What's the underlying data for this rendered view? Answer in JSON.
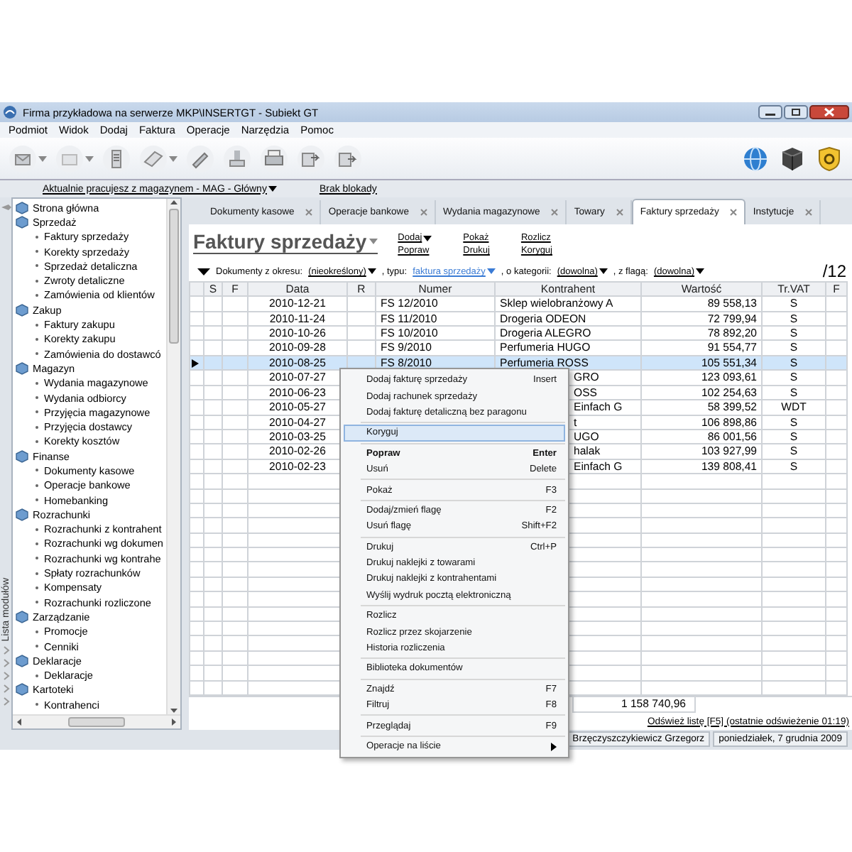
{
  "window": {
    "title": "Firma przykładowa na serwerze MKP\\INSERTGT - Subiekt GT"
  },
  "menu_bar": [
    "Podmiot",
    "Widok",
    "Dodaj",
    "Faktura",
    "Operacje",
    "Narzędzia",
    "Pomoc"
  ],
  "info_bar": {
    "warehouse": "Aktualnie pracujesz z magazynem - MAG - Główny",
    "lock": "Brak blokady"
  },
  "sidebar": {
    "label": "Lista modułów",
    "groups": [
      {
        "label": "Strona główna"
      },
      {
        "label": "Sprzedaż",
        "children": [
          "Faktury sprzedaży",
          "Korekty sprzedaży",
          "Sprzedaż detaliczna",
          "Zwroty detaliczne",
          "Zamówienia od klientów"
        ]
      },
      {
        "label": "Zakup",
        "children": [
          "Faktury zakupu",
          "Korekty zakupu",
          "Zamówienia do dostawcó"
        ]
      },
      {
        "label": "Magazyn",
        "children": [
          "Wydania magazynowe",
          "Wydania odbiorcy",
          "Przyjęcia magazynowe",
          "Przyjęcia dostawcy",
          "Korekty kosztów"
        ]
      },
      {
        "label": "Finanse",
        "children": [
          "Dokumenty kasowe",
          "Operacje bankowe",
          "Homebanking"
        ]
      },
      {
        "label": "Rozrachunki",
        "children": [
          "Rozrachunki z kontrahent",
          "Rozrachunki wg dokumen",
          "Rozrachunki wg kontrahe",
          "Spłaty rozrachunków",
          "Kompensaty",
          "Rozrachunki rozliczone"
        ]
      },
      {
        "label": "Zarządzanie",
        "children": [
          "Promocje",
          "Cenniki"
        ]
      },
      {
        "label": "Deklaracje",
        "children": [
          "Deklaracje"
        ]
      },
      {
        "label": "Kartoteki",
        "children": [
          "Kontrahenci"
        ]
      }
    ]
  },
  "tabs": [
    {
      "label": "Dokumenty kasowe",
      "selected": false
    },
    {
      "label": "Operacje bankowe",
      "selected": false
    },
    {
      "label": "Wydania magazynowe",
      "selected": false
    },
    {
      "label": "Towary",
      "selected": false
    },
    {
      "label": "Faktury sprzedaży",
      "selected": true
    },
    {
      "label": "Instytucje",
      "selected": false
    }
  ],
  "view": {
    "title": "Faktury sprzedaży",
    "actions": [
      {
        "label": "Dodaj",
        "dropdown": true
      },
      {
        "label": "Popraw",
        "dropdown": false
      },
      {
        "label": "Pokaż",
        "dropdown": false
      },
      {
        "label": "Drukuj",
        "dropdown": false
      },
      {
        "label": "Rozlicz",
        "dropdown": false
      },
      {
        "label": "Koryguj",
        "dropdown": false
      }
    ]
  },
  "filter": {
    "parts": [
      {
        "kind": "text",
        "text": "Dokumenty z okresu:"
      },
      {
        "kind": "choice",
        "text": "(nieokreślony)"
      },
      {
        "kind": "text",
        "text": ", typu:"
      },
      {
        "kind": "type",
        "text": "faktura sprzedaży"
      },
      {
        "kind": "text",
        "text": ", o kategorii:"
      },
      {
        "kind": "choice",
        "text": "(dowolna)"
      },
      {
        "kind": "text",
        "text": ", z flagą:"
      },
      {
        "kind": "choice",
        "text": "(dowolna)"
      }
    ],
    "count": "/12"
  },
  "table": {
    "columns": [
      "S",
      "F",
      "Data",
      "R",
      "Numer",
      "Kontrahent",
      "Wartość",
      "Tr.VAT",
      "F"
    ],
    "rows": [
      {
        "date": "2010-12-21",
        "number": "FS 12/2010",
        "contractor": "Sklep wielobranżowy  A",
        "value": "89 558,13",
        "vat": "S",
        "selected": false,
        "partly_hidden": false
      },
      {
        "date": "2010-11-24",
        "number": "FS 11/2010",
        "contractor": "Drogeria ODEON",
        "value": "72 799,94",
        "vat": "S",
        "selected": false,
        "partly_hidden": false
      },
      {
        "date": "2010-10-26",
        "number": "FS 10/2010",
        "contractor": "Drogeria ALEGRO",
        "value": "78 892,20",
        "vat": "S",
        "selected": false,
        "partly_hidden": false
      },
      {
        "date": "2010-09-28",
        "number": "FS 9/2010",
        "contractor": "Perfumeria HUGO",
        "value": "91 554,77",
        "vat": "S",
        "selected": false,
        "partly_hidden": false
      },
      {
        "date": "2010-08-25",
        "number": "FS 8/2010",
        "contractor": "Perfumeria ROSS",
        "value": "105 551,34",
        "vat": "S",
        "selected": true,
        "partly_hidden": false
      },
      {
        "date": "2010-07-27",
        "contractor": "GRO",
        "value": "123 093,61",
        "vat": "S",
        "selected": false,
        "partly_hidden": true
      },
      {
        "date": "2010-06-23",
        "contractor": "OSS",
        "value": "102 254,63",
        "vat": "S",
        "selected": false,
        "partly_hidden": true
      },
      {
        "date": "2010-05-27",
        "contractor": "Einfach G",
        "value": "58 399,52",
        "vat": "WDT",
        "selected": false,
        "partly_hidden": true
      },
      {
        "date": "2010-04-27",
        "contractor": "t",
        "value": "106 898,86",
        "vat": "S",
        "selected": false,
        "partly_hidden": true
      },
      {
        "date": "2010-03-25",
        "contractor": "UGO",
        "value": "86 001,56",
        "vat": "S",
        "selected": false,
        "partly_hidden": true
      },
      {
        "date": "2010-02-26",
        "contractor": "halak",
        "value": "103 927,99",
        "vat": "S",
        "selected": false,
        "partly_hidden": true
      },
      {
        "date": "2010-02-23",
        "contractor": "Einfach G",
        "value": "139 808,41",
        "vat": "S",
        "selected": false,
        "partly_hidden": true
      }
    ],
    "total": "1 158 740,96",
    "refresh": "Odśwież listę [F5] (ostatnie odświeżenie 01:19)"
  },
  "context_menu": {
    "items": [
      {
        "kind": "item",
        "label": "Dodaj fakturę sprzedaży",
        "shortcut": "Insert",
        "selected": false,
        "default": false,
        "submenu": false
      },
      {
        "kind": "item",
        "label": "Dodaj rachunek sprzedaży",
        "selected": false,
        "default": false,
        "submenu": false
      },
      {
        "kind": "item",
        "label": "Dodaj fakturę detaliczną bez paragonu",
        "selected": false,
        "default": false,
        "submenu": false
      },
      {
        "kind": "separator"
      },
      {
        "kind": "item",
        "label": "Koryguj",
        "selected": true,
        "default": false,
        "submenu": false
      },
      {
        "kind": "separator"
      },
      {
        "kind": "item",
        "label": "Popraw",
        "shortcut": "Enter",
        "selected": false,
        "default": true,
        "submenu": false
      },
      {
        "kind": "item",
        "label": "Usuń",
        "shortcut": "Delete",
        "selected": false,
        "default": false,
        "submenu": false
      },
      {
        "kind": "separator"
      },
      {
        "kind": "item",
        "label": "Pokaż",
        "shortcut": "F3",
        "selected": false,
        "default": false,
        "submenu": false
      },
      {
        "kind": "separator"
      },
      {
        "kind": "item",
        "label": "Dodaj/zmień flagę",
        "shortcut": "F2",
        "selected": false,
        "default": false,
        "submenu": false
      },
      {
        "kind": "item",
        "label": "Usuń flagę",
        "shortcut": "Shift+F2",
        "selected": false,
        "default": false,
        "submenu": false
      },
      {
        "kind": "separator"
      },
      {
        "kind": "item",
        "label": "Drukuj",
        "shortcut": "Ctrl+P",
        "selected": false,
        "default": false,
        "submenu": false
      },
      {
        "kind": "item",
        "label": "Drukuj naklejki z towarami",
        "selected": false,
        "default": false,
        "submenu": false
      },
      {
        "kind": "item",
        "label": "Drukuj naklejki z kontrahentami",
        "selected": false,
        "default": false,
        "submenu": false
      },
      {
        "kind": "item",
        "label": "Wyślij wydruk pocztą elektroniczną",
        "selected": false,
        "default": false,
        "submenu": false
      },
      {
        "kind": "separator"
      },
      {
        "kind": "item",
        "label": "Rozlicz",
        "selected": false,
        "default": false,
        "submenu": false
      },
      {
        "kind": "item",
        "label": "Rozlicz przez skojarzenie",
        "selected": false,
        "default": false,
        "submenu": false
      },
      {
        "kind": "item",
        "label": "Historia rozliczenia",
        "selected": false,
        "default": false,
        "submenu": false
      },
      {
        "kind": "separator"
      },
      {
        "kind": "item",
        "label": "Biblioteka dokumentów",
        "selected": false,
        "default": false,
        "submenu": false
      },
      {
        "kind": "separator"
      },
      {
        "kind": "item",
        "label": "Znajdź",
        "shortcut": "F7",
        "selected": false,
        "default": false,
        "submenu": false
      },
      {
        "kind": "item",
        "label": "Filtruj",
        "shortcut": "F8",
        "selected": false,
        "default": false,
        "submenu": false
      },
      {
        "kind": "separator"
      },
      {
        "kind": "item",
        "label": "Przeglądaj",
        "shortcut": "F9",
        "selected": false,
        "default": false,
        "submenu": false
      },
      {
        "kind": "separator"
      },
      {
        "kind": "item",
        "label": "Operacje na liście",
        "selected": false,
        "default": false,
        "submenu": true
      }
    ]
  },
  "status_bar": [
    "Brzęczyszczykiewicz Grzegorz",
    "poniedziałek, 7 grudnia 2009"
  ]
}
